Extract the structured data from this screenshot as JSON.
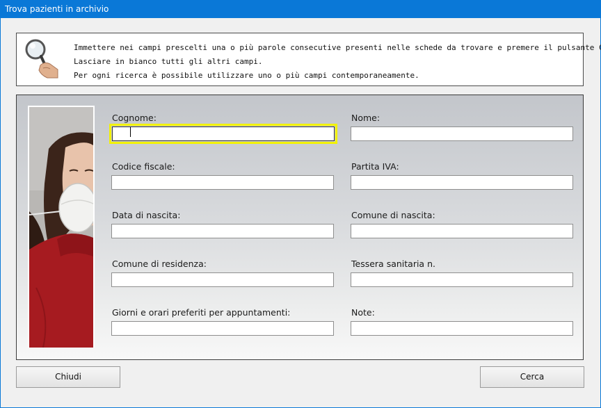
{
  "window": {
    "title": "Trova pazienti in archivio"
  },
  "info": {
    "icon": "magnifier-hand-icon",
    "lines": [
      "Immettere nei campi prescelti una o più parole consecutive presenti nelle schede da trovare e premere il pulsante Cerca.",
      "Lasciare in bianco tutti gli altri campi.",
      "Per ogni ricerca è possibile utilizzare uno o più campi contemporaneamente."
    ]
  },
  "form": {
    "cognome": {
      "label": "Cognome:",
      "value": ""
    },
    "nome": {
      "label": "Nome:",
      "value": ""
    },
    "codice_fiscale": {
      "label": "Codice fiscale:",
      "value": ""
    },
    "partita_iva": {
      "label": "Partita IVA:",
      "value": ""
    },
    "data_nascita": {
      "label": "Data di nascita:",
      "value": ""
    },
    "comune_nascita": {
      "label": "Comune di nascita:",
      "value": ""
    },
    "comune_residenza": {
      "label": "Comune di residenza:",
      "value": ""
    },
    "tessera_sanitaria": {
      "label": "Tessera sanitaria n.",
      "value": ""
    },
    "giorni_orari": {
      "label": "Giorni e orari preferiti per appuntamenti:",
      "value": ""
    },
    "note": {
      "label": "Note:",
      "value": ""
    }
  },
  "buttons": {
    "close_label": "Chiudi",
    "search_label": "Cerca"
  },
  "colors": {
    "titlebar": "#0a78d7",
    "focus_highlight": "#f2f200"
  }
}
